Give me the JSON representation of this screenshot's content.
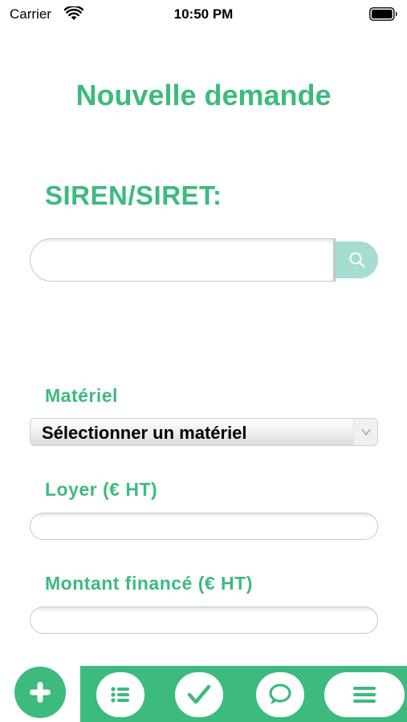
{
  "status_bar": {
    "carrier": "Carrier",
    "time": "10:50 PM"
  },
  "page": {
    "title": "Nouvelle demande"
  },
  "siren": {
    "label": "SIREN/SIRET:",
    "value": ""
  },
  "form": {
    "materiel_label": "Matériel",
    "materiel_select": "Sélectionner un matériel",
    "loyer_label": "Loyer (€ HT)",
    "loyer_value": "",
    "montant_label": "Montant financé (€ HT)",
    "montant_value": ""
  },
  "colors": {
    "accent": "#3dba7e",
    "search_button": "#a6ddd2"
  },
  "bottom_nav": {
    "items": [
      "plus-icon",
      "list-icon",
      "checkmark-icon",
      "chat-bubble-icon",
      "menu-icon"
    ]
  }
}
